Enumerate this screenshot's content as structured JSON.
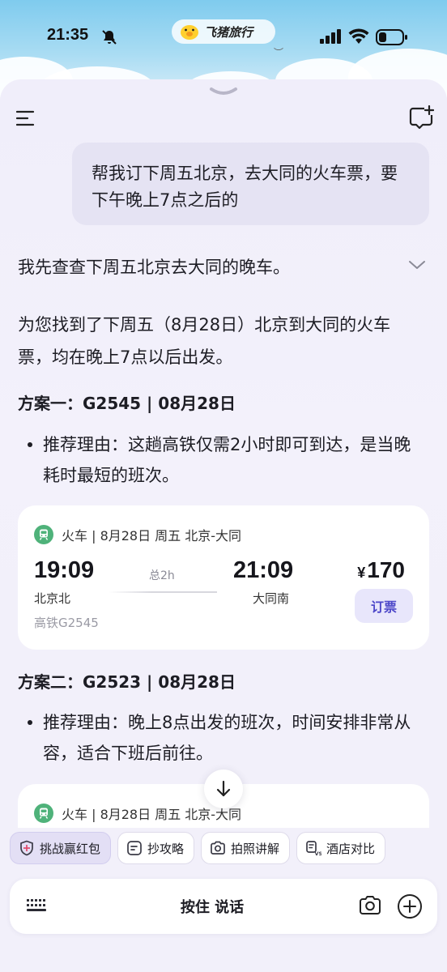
{
  "status_bar": {
    "time": "21:35",
    "brand_name": "飞猪旅行"
  },
  "chat": {
    "user_message": "帮我订下周五北京，去大同的火车票，要下午晚上7点之后的",
    "thinking": "我先查查下周五北京去大同的晚车。",
    "answer_intro": "为您找到了下周五（8月28日）北京到大同的火车票，均在晚上7点以后出发。",
    "plans": [
      {
        "title": "方案一：G2545 | 08月28日",
        "reason": "推荐理由：这趟高铁仅需2小时即可到达，是当晚耗时最短的班次。",
        "card": {
          "meta": "火车 | 8月28日 周五 北京-大同",
          "dep_time": "19:09",
          "duration": "总2h",
          "arr_time": "21:09",
          "dep_station": "北京北",
          "arr_station": "大同南",
          "train_no": "高铁G2545",
          "price_symbol": "¥",
          "price": "170",
          "book_label": "订票"
        }
      },
      {
        "title": "方案二：G2523 | 08月28日",
        "reason": "推荐理由：晚上8点出发的班次，时间安排非常从容，适合下班后前往。",
        "card": {
          "meta": "火车 | 8月28日 周五 北京-大同"
        }
      }
    ]
  },
  "chips": [
    {
      "label": "挑战赢红包",
      "icon": "shield-gift-icon"
    },
    {
      "label": "抄攻略",
      "icon": "note-icon"
    },
    {
      "label": "拍照讲解",
      "icon": "camera-spark-icon"
    },
    {
      "label": "酒店对比",
      "icon": "compare-icon"
    }
  ],
  "input_bar": {
    "hold_to_talk": "按住 说话"
  },
  "colors": {
    "accent": "#4d47c9",
    "train_icon": "#4fb27a",
    "bubble": "#e5e3f3"
  }
}
